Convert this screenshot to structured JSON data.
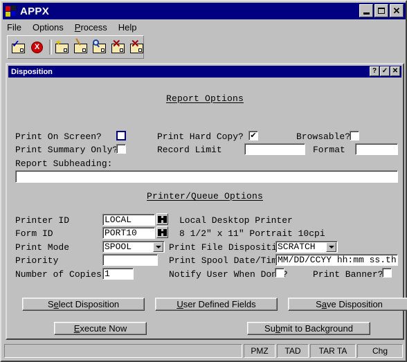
{
  "window": {
    "title": "APPX",
    "icon": "windows-logo-icon",
    "buttons": {
      "minimize": "minimize-icon",
      "maximize": "maximize-icon",
      "close": "close-icon"
    }
  },
  "menu": [
    {
      "label": "File",
      "accel": ""
    },
    {
      "label": "Options",
      "accel": ""
    },
    {
      "label": "Process",
      "accel": "P"
    },
    {
      "label": "Help",
      "accel": ""
    }
  ],
  "toolbar": [
    {
      "name": "confirm-folder-icon",
      "glyph": "check"
    },
    {
      "name": "cancel-stop-icon",
      "glyph": "stop",
      "label": "X"
    },
    {
      "name": "new-folder-icon",
      "glyph": "star"
    },
    {
      "name": "edit-folder-icon",
      "glyph": "pencil"
    },
    {
      "name": "find-folder-icon",
      "glyph": "magnifier"
    },
    {
      "name": "delete-folder-icon",
      "glyph": "x"
    },
    {
      "name": "delete-all-folder-icon",
      "glyph": "x2"
    }
  ],
  "dialog": {
    "title": "Disposition",
    "buttons": {
      "help": "?",
      "ok": "✓",
      "close": "✕"
    },
    "report_options": {
      "heading": "Report Options",
      "print_on_screen_label": "Print On Screen?",
      "print_on_screen_checked": false,
      "print_hard_copy_label": "Print Hard Copy?",
      "print_hard_copy_checked": true,
      "print_hard_copy_mark": "✔",
      "browsable_label": "Browsable?",
      "browsable_checked": false,
      "print_summary_only_label": "Print Summary Only?",
      "print_summary_only_checked": false,
      "record_limit_label": "Record Limit",
      "record_limit_value": "",
      "format_label": "Format",
      "format_value": "",
      "report_subheading_label": "Report Subheading:",
      "report_subheading_value": ""
    },
    "printer_queue_options": {
      "heading": "Printer/Queue Options",
      "printer_id_label": "Printer ID",
      "printer_id_value": "LOCAL",
      "printer_id_desc": "Local Desktop Printer",
      "printer_id_lookup": "binoculars-icon",
      "form_id_label": "Form ID",
      "form_id_value": "PORT10",
      "form_id_desc": "8 1/2\" x 11\" Portrait 10cpi",
      "form_id_lookup": "binoculars-icon",
      "print_mode_label": "Print Mode",
      "print_mode_value": "SPOOL",
      "print_file_disposition_label": "Print File Disposition",
      "print_file_disposition_value": "SCRATCH",
      "priority_label": "Priority",
      "priority_value": "",
      "print_spool_datetime_label": "Print Spool Date/Time",
      "print_spool_datetime_value": "MM/DD/CCYY hh:mm ss.th",
      "number_of_copies_label": "Number of Copies",
      "number_of_copies_value": "1",
      "notify_user_label": "Notify User When Done?",
      "notify_user_checked": false,
      "print_banner_label": "Print Banner?",
      "print_banner_checked": false
    },
    "actions": {
      "select_disposition": {
        "pre": "S",
        "accel": "e",
        "post": "lect Disposition"
      },
      "user_defined_fields": {
        "pre": "",
        "accel": "U",
        "post": "ser Defined Fields"
      },
      "save_disposition": {
        "pre": "S",
        "accel": "a",
        "post": "ve Disposition"
      },
      "execute_now": {
        "pre": "",
        "accel": "E",
        "post": "xecute Now"
      },
      "submit_to_background": {
        "pre": "Su",
        "accel": "b",
        "post": "mit to Background"
      }
    }
  },
  "status_bar": {
    "main": "",
    "cells": [
      "PMZ",
      "TAD",
      "TAR TA",
      "Chg"
    ]
  },
  "colors": {
    "titlebar": "#000080",
    "face": "#c0c0c0",
    "field_bg": "#ffffff",
    "focus_border": "#000080"
  }
}
